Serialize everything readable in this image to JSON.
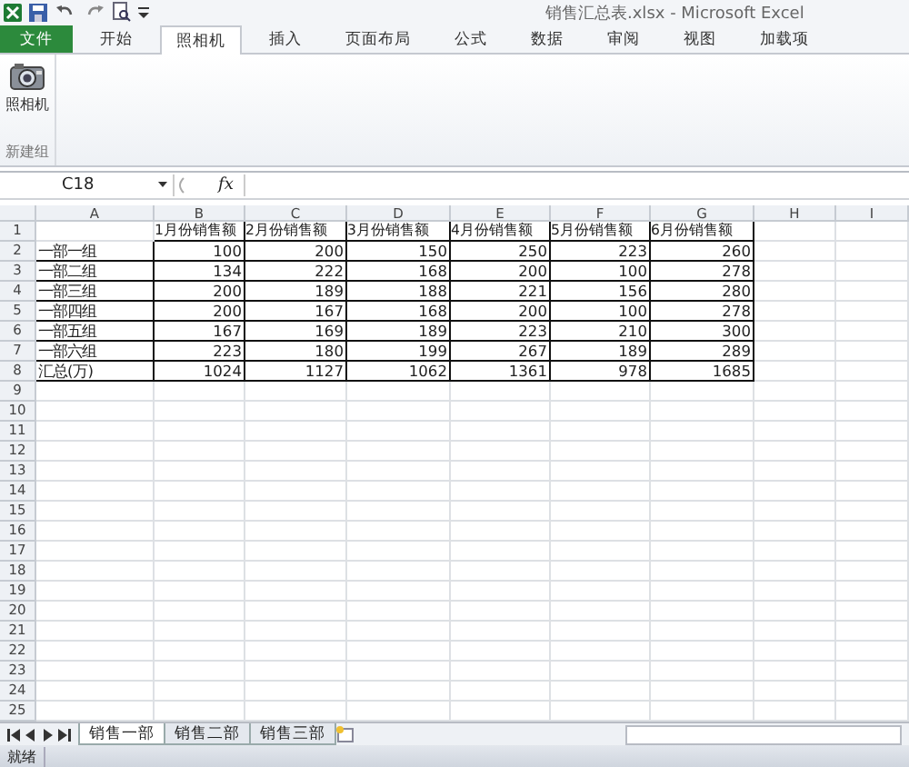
{
  "window": {
    "title": "销售汇总表.xlsx - Microsoft Excel"
  },
  "tabs": [
    {
      "label": "文件",
      "kind": "file",
      "selected": false
    },
    {
      "label": "开始",
      "kind": "tab",
      "selected": false
    },
    {
      "label": "照相机",
      "kind": "tab",
      "selected": true
    },
    {
      "label": "插入",
      "kind": "tab",
      "selected": false
    },
    {
      "label": "页面布局",
      "kind": "tab",
      "selected": false
    },
    {
      "label": "公式",
      "kind": "tab",
      "selected": false
    },
    {
      "label": "数据",
      "kind": "tab",
      "selected": false
    },
    {
      "label": "审阅",
      "kind": "tab",
      "selected": false
    },
    {
      "label": "视图",
      "kind": "tab",
      "selected": false
    },
    {
      "label": "加载项",
      "kind": "tab",
      "selected": false
    }
  ],
  "ribbon": {
    "button": "照相机",
    "group": "新建组"
  },
  "formula_bar": {
    "name_box": "C18",
    "fx": "fx"
  },
  "columns": [
    "A",
    "B",
    "C",
    "D",
    "E",
    "F",
    "G",
    "H",
    "I"
  ],
  "rows": [
    {
      "header": "1",
      "kind": "header",
      "cells": [
        null,
        "1月份销售额",
        "2月份销售额",
        "3月份销售额",
        "4月份销售额",
        "5月份销售额",
        "6月份销售额"
      ]
    },
    {
      "header": "2",
      "kind": "data",
      "cells": [
        "一部一组",
        "100",
        "200",
        "150",
        "250",
        "223",
        "260"
      ]
    },
    {
      "header": "3",
      "kind": "data",
      "cells": [
        "一部二组",
        "134",
        "222",
        "168",
        "200",
        "100",
        "278"
      ]
    },
    {
      "header": "4",
      "kind": "data",
      "cells": [
        "一部三组",
        "200",
        "189",
        "188",
        "221",
        "156",
        "280"
      ]
    },
    {
      "header": "5",
      "kind": "data",
      "cells": [
        "一部四组",
        "200",
        "167",
        "168",
        "200",
        "100",
        "278"
      ]
    },
    {
      "header": "6",
      "kind": "data",
      "cells": [
        "一部五组",
        "167",
        "169",
        "189",
        "223",
        "210",
        "300"
      ]
    },
    {
      "header": "7",
      "kind": "data",
      "cells": [
        "一部六组",
        "223",
        "180",
        "199",
        "267",
        "189",
        "289"
      ]
    },
    {
      "header": "8",
      "kind": "data",
      "cells": [
        "汇总(万)",
        "1024",
        "1127",
        "1062",
        "1361",
        "978",
        "1685"
      ]
    },
    {
      "header": "9"
    },
    {
      "header": "10"
    },
    {
      "header": "11"
    },
    {
      "header": "12"
    },
    {
      "header": "13"
    },
    {
      "header": "14"
    },
    {
      "header": "15"
    },
    {
      "header": "16"
    },
    {
      "header": "17"
    },
    {
      "header": "18"
    },
    {
      "header": "19"
    },
    {
      "header": "20"
    },
    {
      "header": "21"
    },
    {
      "header": "22"
    },
    {
      "header": "23"
    },
    {
      "header": "24"
    },
    {
      "header": "25"
    }
  ],
  "sheets": [
    {
      "label": "销售一部",
      "selected": true
    },
    {
      "label": "销售二部",
      "selected": false
    },
    {
      "label": "销售三部",
      "selected": false
    }
  ],
  "status_bar": {
    "text": "就绪"
  }
}
